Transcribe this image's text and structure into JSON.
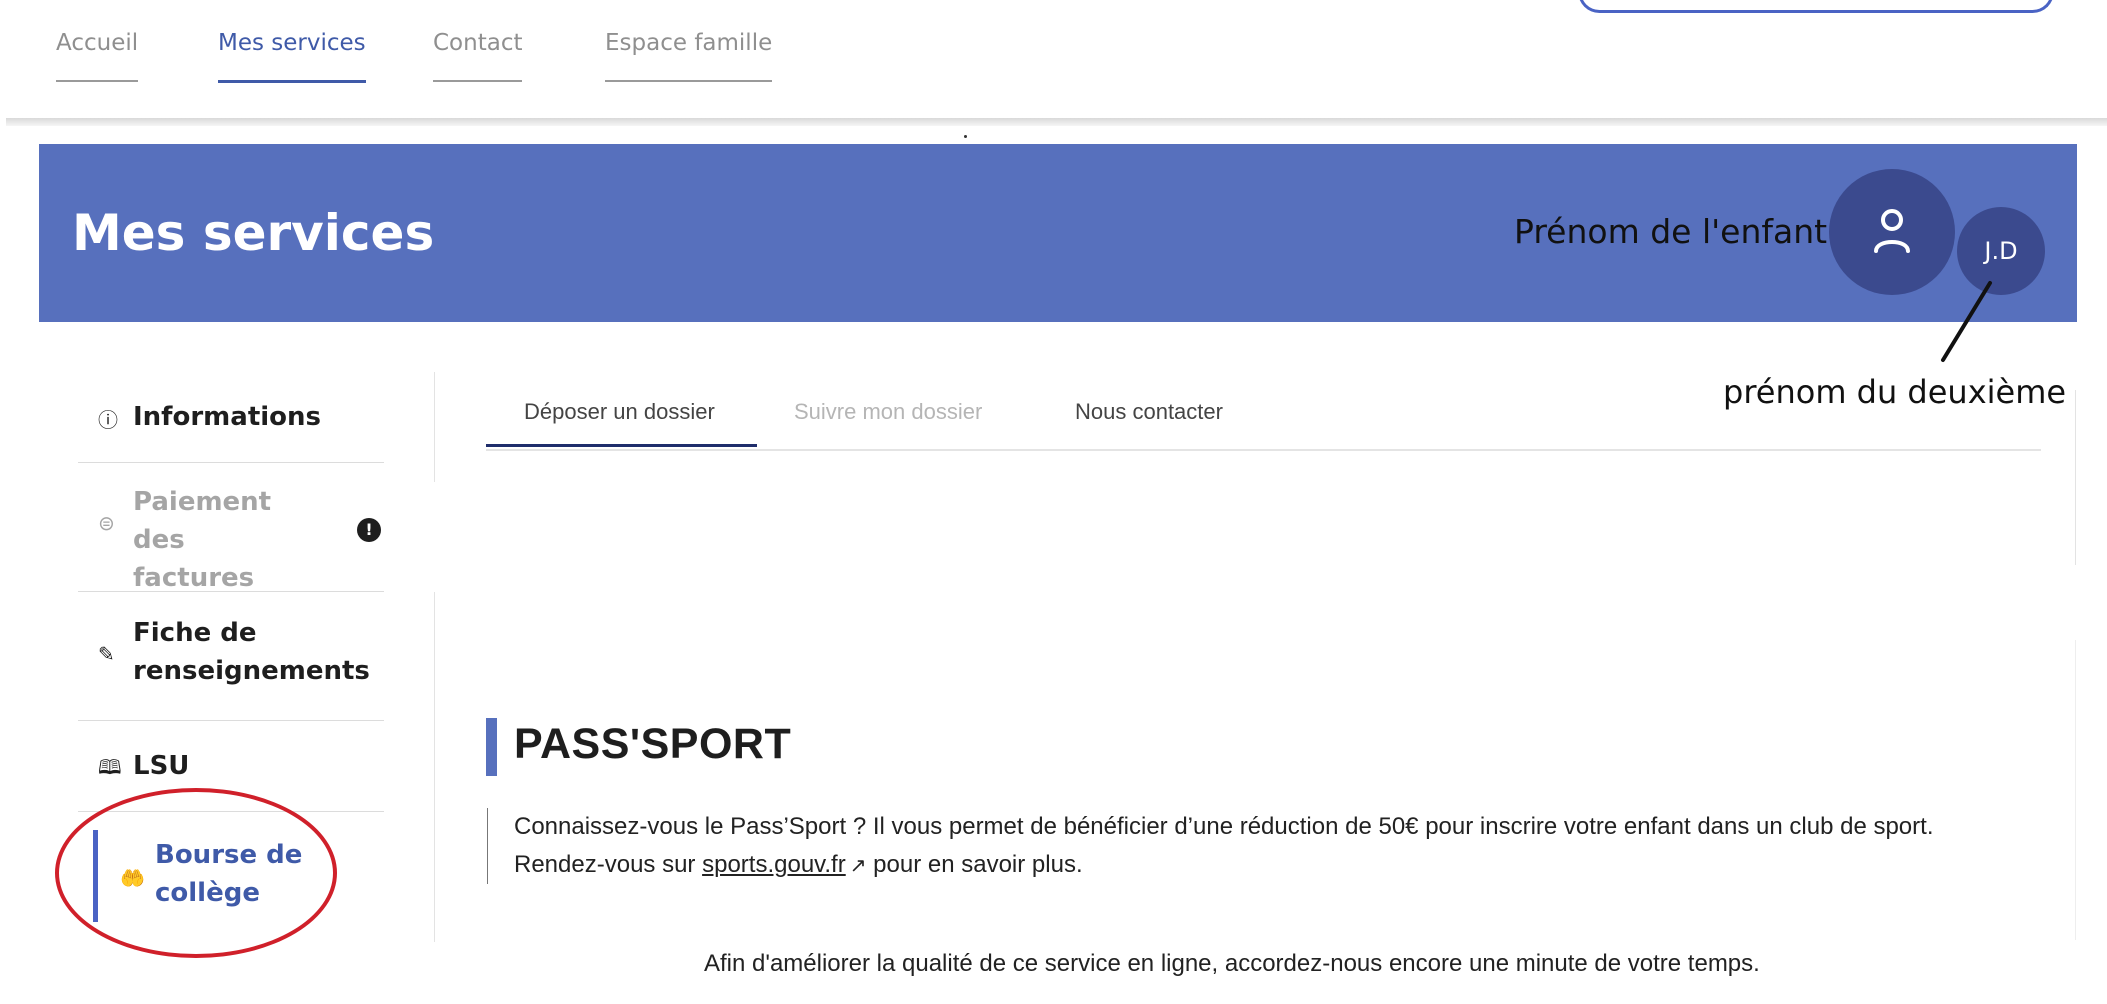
{
  "topnav": {
    "items": [
      {
        "label": "Accueil"
      },
      {
        "label": "Mes services"
      },
      {
        "label": "Contact"
      },
      {
        "label": "Espace famille"
      }
    ]
  },
  "banner": {
    "title": "Mes services",
    "child_name": "Prénom de l'enfant",
    "second_child_initials": "J.D",
    "second_child_annotation": "prénom du deuxième"
  },
  "sidebar": {
    "items": [
      {
        "label": "Informations",
        "icon": "info-icon"
      },
      {
        "label": "Paiement des factures",
        "icon": "payment-icon",
        "state": "disabled"
      },
      {
        "label": "Fiche de renseignements",
        "icon": "form-edit-icon"
      },
      {
        "label": "LSU",
        "icon": "book-icon"
      },
      {
        "label": "Bourse de collège",
        "icon": "hand-coins-icon",
        "state": "active"
      }
    ],
    "warning_badge": "!"
  },
  "tabs": [
    {
      "label": "Déposer un dossier",
      "state": "active"
    },
    {
      "label": "Suivre mon dossier",
      "state": "disabled"
    },
    {
      "label": "Nous contacter"
    }
  ],
  "content": {
    "title": "PASS'SPORT",
    "text_before": "Connaissez-vous le Pass’Sport ? Il vous permet de bénéficier d’une réduction de 50€ pour inscrire votre enfant dans un club de sport.",
    "text_line2_before": "Rendez-vous sur",
    "link_text": "sports.gouv.fr",
    "text_line2_after": "pour en savoir plus.",
    "survey_text": "Afin d'améliorer la qualité de ce service en ligne, accordez-nous encore une minute de votre temps."
  },
  "colors": {
    "primary": "#5770bd",
    "avatar": "#3b4a8e",
    "active_text": "#3f5aa8",
    "annotation_red": "#d0202a"
  }
}
